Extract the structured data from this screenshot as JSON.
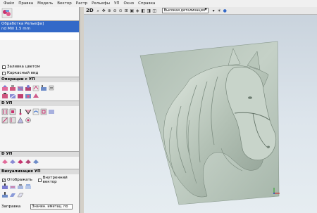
{
  "menu": [
    "Файл",
    "Правка",
    "Модель",
    "Вектор",
    "Растр",
    "Рельефы",
    "УП",
    "Окно",
    "Справка"
  ],
  "tree": {
    "selected_line1": "Обработка Рельефа]",
    "selected_line2": "nd Mill 1.5 mm"
  },
  "checks": {
    "fill_color": "Заливка цветом",
    "wireframe": "Каркасный вид"
  },
  "sections": {
    "operations": "Операции с УП",
    "d2": "D УП",
    "d3": "D УП",
    "visualization": "Визуализация УП"
  },
  "visualization": {
    "display": "Отображать",
    "inner_vector": "Внутренний вектор"
  },
  "bottom": {
    "label": "Заправка",
    "combo": "Значен. имитац. по"
  },
  "viewport_toolbar": {
    "mode": "2D",
    "detail": "Высокая детализация"
  },
  "colors": {
    "selection": "#3369c8",
    "relief_plane": "#9fb0a3",
    "relief_light": "#cfd9d0"
  }
}
